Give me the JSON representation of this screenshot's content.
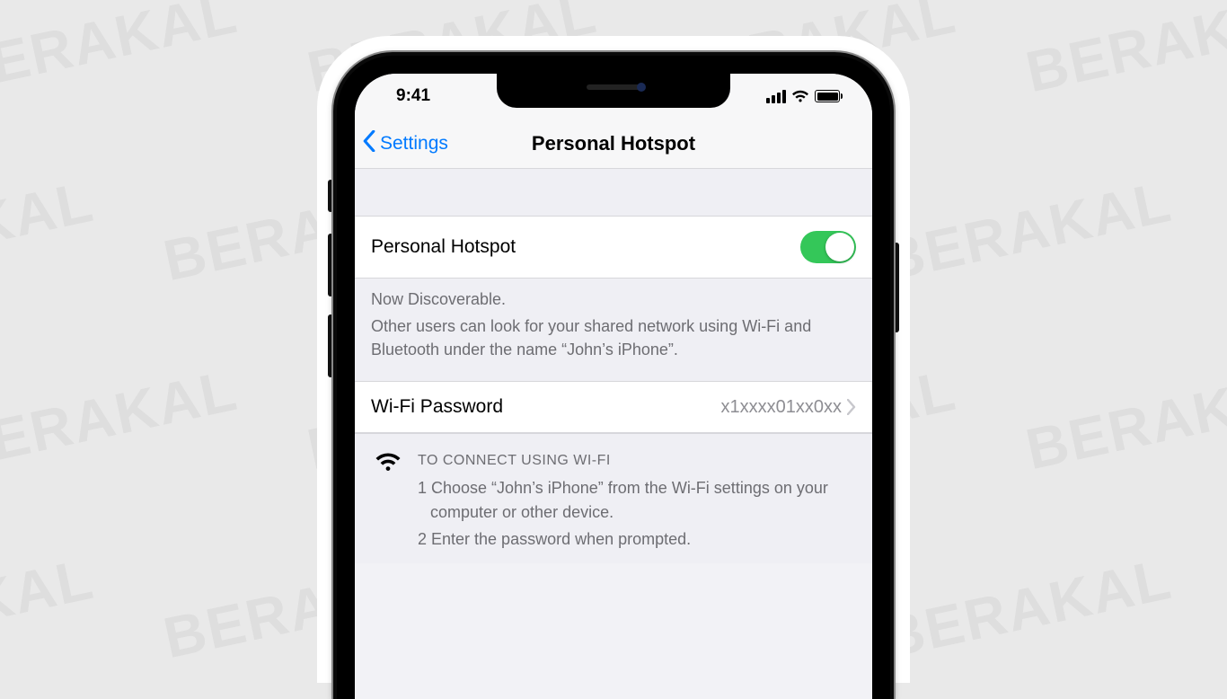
{
  "watermark": "BERAKAL",
  "statusbar": {
    "time": "9:41"
  },
  "nav": {
    "back_label": "Settings",
    "title": "Personal Hotspot"
  },
  "hotspot": {
    "toggle_label": "Personal Hotspot",
    "toggle_on": true,
    "discoverable_head": "Now Discoverable.",
    "discoverable_body": "Other users can look for your shared network using Wi-Fi and Bluetooth under the name “John’s iPhone”."
  },
  "wifi": {
    "label": "Wi-Fi Password",
    "value": "x1xxxx01xx0xx"
  },
  "connect": {
    "header": "TO CONNECT USING WI-FI",
    "step1": "1 Choose “John’s iPhone” from the Wi-Fi settings on your computer or other device.",
    "step2": "2 Enter the password when prompted."
  }
}
